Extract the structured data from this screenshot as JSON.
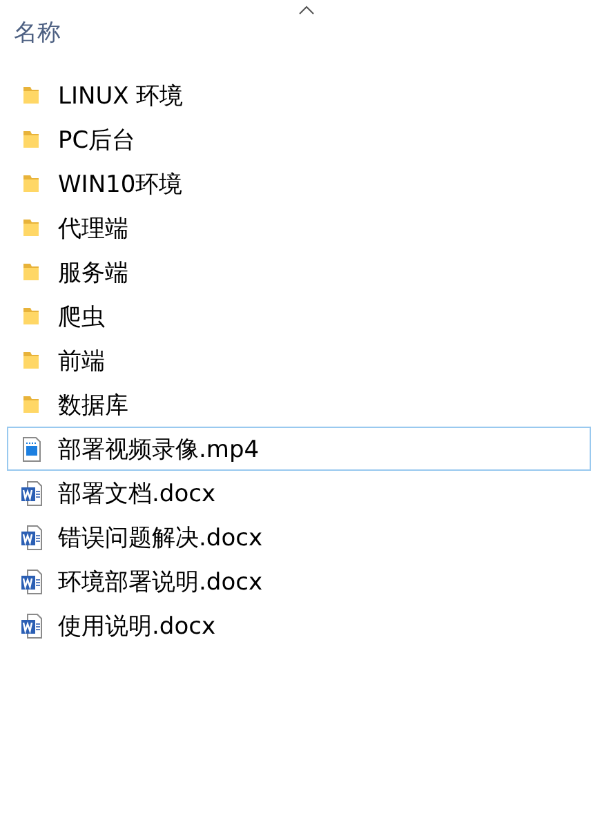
{
  "columns": [
    {
      "label": "名称",
      "sorted": true
    }
  ],
  "items": [
    {
      "name": "LINUX 环境",
      "kind": "folder",
      "focused": false
    },
    {
      "name": "PC后台",
      "kind": "folder",
      "focused": false
    },
    {
      "name": "WIN10环境",
      "kind": "folder",
      "focused": false
    },
    {
      "name": "代理端",
      "kind": "folder",
      "focused": false
    },
    {
      "name": "服务端",
      "kind": "folder",
      "focused": false
    },
    {
      "name": "爬虫",
      "kind": "folder",
      "focused": false
    },
    {
      "name": "前端",
      "kind": "folder",
      "focused": false
    },
    {
      "name": "数据库",
      "kind": "folder",
      "focused": false
    },
    {
      "name": "部署视频录像.mp4",
      "kind": "video",
      "focused": true
    },
    {
      "name": "部署文档.docx",
      "kind": "word",
      "focused": false
    },
    {
      "name": "错误问题解决.docx",
      "kind": "word",
      "focused": false
    },
    {
      "name": "环境部署说明.docx",
      "kind": "word",
      "focused": false
    },
    {
      "name": "使用说明.docx",
      "kind": "word",
      "focused": false
    }
  ]
}
